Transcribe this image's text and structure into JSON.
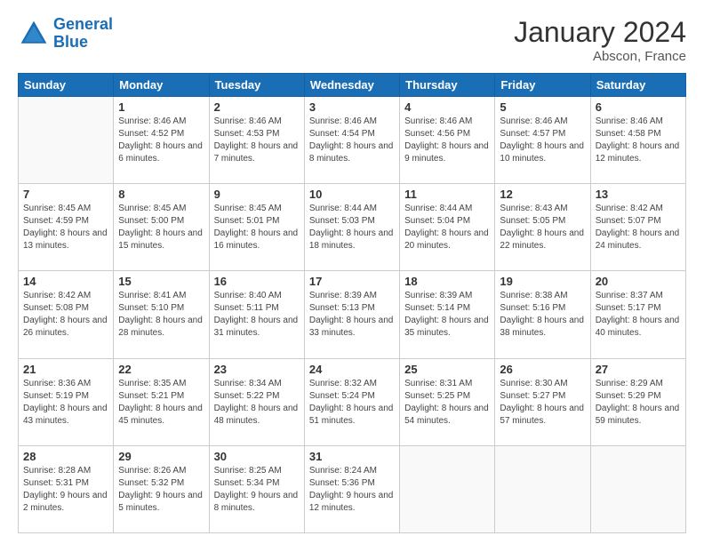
{
  "logo": {
    "text_general": "General",
    "text_blue": "Blue"
  },
  "title": "January 2024",
  "subtitle": "Abscon, France",
  "weekdays": [
    "Sunday",
    "Monday",
    "Tuesday",
    "Wednesday",
    "Thursday",
    "Friday",
    "Saturday"
  ],
  "weeks": [
    [
      {
        "day": null
      },
      {
        "day": 1,
        "sunrise": "Sunrise: 8:46 AM",
        "sunset": "Sunset: 4:52 PM",
        "daylight": "Daylight: 8 hours and 6 minutes."
      },
      {
        "day": 2,
        "sunrise": "Sunrise: 8:46 AM",
        "sunset": "Sunset: 4:53 PM",
        "daylight": "Daylight: 8 hours and 7 minutes."
      },
      {
        "day": 3,
        "sunrise": "Sunrise: 8:46 AM",
        "sunset": "Sunset: 4:54 PM",
        "daylight": "Daylight: 8 hours and 8 minutes."
      },
      {
        "day": 4,
        "sunrise": "Sunrise: 8:46 AM",
        "sunset": "Sunset: 4:56 PM",
        "daylight": "Daylight: 8 hours and 9 minutes."
      },
      {
        "day": 5,
        "sunrise": "Sunrise: 8:46 AM",
        "sunset": "Sunset: 4:57 PM",
        "daylight": "Daylight: 8 hours and 10 minutes."
      },
      {
        "day": 6,
        "sunrise": "Sunrise: 8:46 AM",
        "sunset": "Sunset: 4:58 PM",
        "daylight": "Daylight: 8 hours and 12 minutes."
      }
    ],
    [
      {
        "day": 7,
        "sunrise": "Sunrise: 8:45 AM",
        "sunset": "Sunset: 4:59 PM",
        "daylight": "Daylight: 8 hours and 13 minutes."
      },
      {
        "day": 8,
        "sunrise": "Sunrise: 8:45 AM",
        "sunset": "Sunset: 5:00 PM",
        "daylight": "Daylight: 8 hours and 15 minutes."
      },
      {
        "day": 9,
        "sunrise": "Sunrise: 8:45 AM",
        "sunset": "Sunset: 5:01 PM",
        "daylight": "Daylight: 8 hours and 16 minutes."
      },
      {
        "day": 10,
        "sunrise": "Sunrise: 8:44 AM",
        "sunset": "Sunset: 5:03 PM",
        "daylight": "Daylight: 8 hours and 18 minutes."
      },
      {
        "day": 11,
        "sunrise": "Sunrise: 8:44 AM",
        "sunset": "Sunset: 5:04 PM",
        "daylight": "Daylight: 8 hours and 20 minutes."
      },
      {
        "day": 12,
        "sunrise": "Sunrise: 8:43 AM",
        "sunset": "Sunset: 5:05 PM",
        "daylight": "Daylight: 8 hours and 22 minutes."
      },
      {
        "day": 13,
        "sunrise": "Sunrise: 8:42 AM",
        "sunset": "Sunset: 5:07 PM",
        "daylight": "Daylight: 8 hours and 24 minutes."
      }
    ],
    [
      {
        "day": 14,
        "sunrise": "Sunrise: 8:42 AM",
        "sunset": "Sunset: 5:08 PM",
        "daylight": "Daylight: 8 hours and 26 minutes."
      },
      {
        "day": 15,
        "sunrise": "Sunrise: 8:41 AM",
        "sunset": "Sunset: 5:10 PM",
        "daylight": "Daylight: 8 hours and 28 minutes."
      },
      {
        "day": 16,
        "sunrise": "Sunrise: 8:40 AM",
        "sunset": "Sunset: 5:11 PM",
        "daylight": "Daylight: 8 hours and 31 minutes."
      },
      {
        "day": 17,
        "sunrise": "Sunrise: 8:39 AM",
        "sunset": "Sunset: 5:13 PM",
        "daylight": "Daylight: 8 hours and 33 minutes."
      },
      {
        "day": 18,
        "sunrise": "Sunrise: 8:39 AM",
        "sunset": "Sunset: 5:14 PM",
        "daylight": "Daylight: 8 hours and 35 minutes."
      },
      {
        "day": 19,
        "sunrise": "Sunrise: 8:38 AM",
        "sunset": "Sunset: 5:16 PM",
        "daylight": "Daylight: 8 hours and 38 minutes."
      },
      {
        "day": 20,
        "sunrise": "Sunrise: 8:37 AM",
        "sunset": "Sunset: 5:17 PM",
        "daylight": "Daylight: 8 hours and 40 minutes."
      }
    ],
    [
      {
        "day": 21,
        "sunrise": "Sunrise: 8:36 AM",
        "sunset": "Sunset: 5:19 PM",
        "daylight": "Daylight: 8 hours and 43 minutes."
      },
      {
        "day": 22,
        "sunrise": "Sunrise: 8:35 AM",
        "sunset": "Sunset: 5:21 PM",
        "daylight": "Daylight: 8 hours and 45 minutes."
      },
      {
        "day": 23,
        "sunrise": "Sunrise: 8:34 AM",
        "sunset": "Sunset: 5:22 PM",
        "daylight": "Daylight: 8 hours and 48 minutes."
      },
      {
        "day": 24,
        "sunrise": "Sunrise: 8:32 AM",
        "sunset": "Sunset: 5:24 PM",
        "daylight": "Daylight: 8 hours and 51 minutes."
      },
      {
        "day": 25,
        "sunrise": "Sunrise: 8:31 AM",
        "sunset": "Sunset: 5:25 PM",
        "daylight": "Daylight: 8 hours and 54 minutes."
      },
      {
        "day": 26,
        "sunrise": "Sunrise: 8:30 AM",
        "sunset": "Sunset: 5:27 PM",
        "daylight": "Daylight: 8 hours and 57 minutes."
      },
      {
        "day": 27,
        "sunrise": "Sunrise: 8:29 AM",
        "sunset": "Sunset: 5:29 PM",
        "daylight": "Daylight: 8 hours and 59 minutes."
      }
    ],
    [
      {
        "day": 28,
        "sunrise": "Sunrise: 8:28 AM",
        "sunset": "Sunset: 5:31 PM",
        "daylight": "Daylight: 9 hours and 2 minutes."
      },
      {
        "day": 29,
        "sunrise": "Sunrise: 8:26 AM",
        "sunset": "Sunset: 5:32 PM",
        "daylight": "Daylight: 9 hours and 5 minutes."
      },
      {
        "day": 30,
        "sunrise": "Sunrise: 8:25 AM",
        "sunset": "Sunset: 5:34 PM",
        "daylight": "Daylight: 9 hours and 8 minutes."
      },
      {
        "day": 31,
        "sunrise": "Sunrise: 8:24 AM",
        "sunset": "Sunset: 5:36 PM",
        "daylight": "Daylight: 9 hours and 12 minutes."
      },
      {
        "day": null
      },
      {
        "day": null
      },
      {
        "day": null
      }
    ]
  ]
}
